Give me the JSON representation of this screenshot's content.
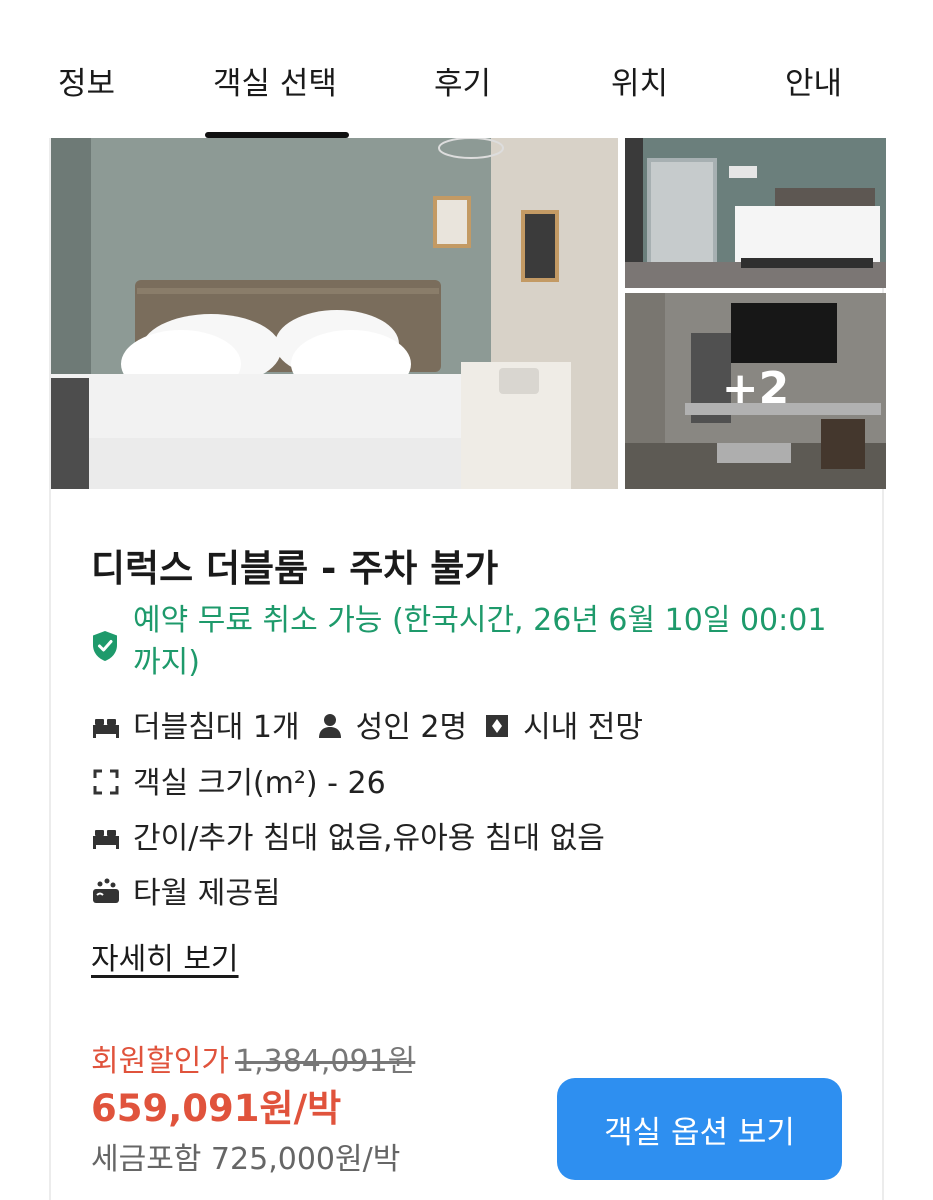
{
  "tabs": [
    {
      "label": "정보"
    },
    {
      "label": "객실 선택"
    },
    {
      "label": "후기"
    },
    {
      "label": "위치"
    },
    {
      "label": "안내"
    }
  ],
  "active_tab_index": 1,
  "photos": {
    "more_label": "+2"
  },
  "room": {
    "title": "디럭스 더블룸 - 주차 불가",
    "cancel_policy": "예약 무료 취소 가능 (한국시간, 26년 6월 10일 00:01까지)",
    "features": {
      "bed": "더블침대 1개",
      "guests": "성인 2명",
      "view": "시내 전망",
      "size": "객실 크기(m²) - 26",
      "extra_bed": "간이/추가 침대 없음,유아용 침대 없음",
      "towel": "타월 제공됨"
    },
    "detail_link": "자세히 보기"
  },
  "pricing": {
    "member_label": "회원할인가",
    "original_price": "1,384,091원",
    "price": "659,091원/박",
    "tax_included": "세금포함 725,000원/박"
  },
  "cta_label": "객실 옵션 보기",
  "colors": {
    "accent_green": "#1e9a6b",
    "price_red": "#e0533c",
    "button_blue": "#2e8ff0"
  },
  "icons": [
    "bed-icon",
    "person-icon",
    "view-icon",
    "size-icon",
    "extra-bed-icon",
    "towel-icon",
    "shield-check-icon"
  ]
}
